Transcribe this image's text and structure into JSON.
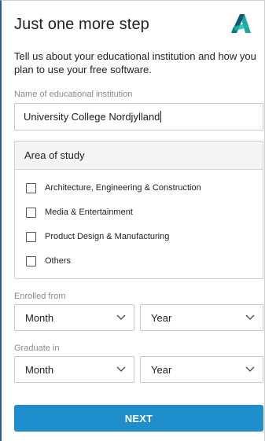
{
  "header": {
    "title": "Just one more step",
    "logo": "autodesk-logo"
  },
  "intro": "Tell us about your educational institution and how you plan to use your free software.",
  "institution": {
    "label": "Name of educational institution",
    "value": "University College Nordjylland"
  },
  "study": {
    "heading": "Area of study",
    "options": [
      {
        "label": "Architecture, Engineering & Construction",
        "checked": false
      },
      {
        "label": "Media & Entertainment",
        "checked": false
      },
      {
        "label": "Product Design & Manufacturing",
        "checked": false
      },
      {
        "label": "Others",
        "checked": false
      }
    ]
  },
  "enrolled": {
    "label": "Enrolled from",
    "month": "Month",
    "year": "Year"
  },
  "graduate": {
    "label": "Graduate in",
    "month": "Month",
    "year": "Year"
  },
  "next_label": "NEXT",
  "colors": {
    "accent": "#1e8ecd",
    "logo_teal": "#1a9e8f",
    "logo_dark": "#0f5c73"
  },
  "icons": {
    "chevron": "chevron-down-icon"
  }
}
